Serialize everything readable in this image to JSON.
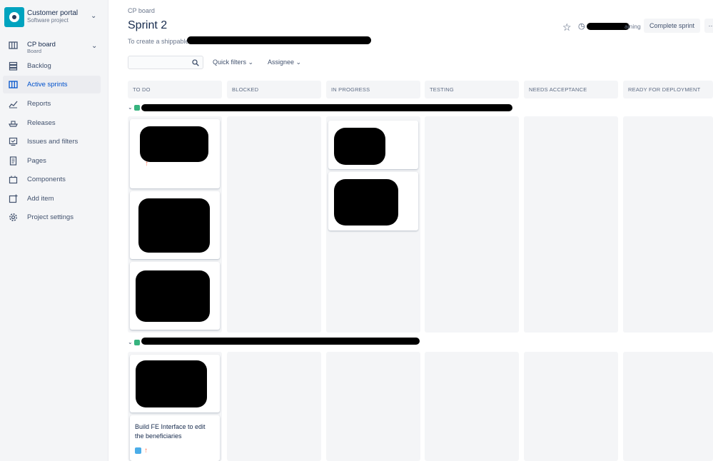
{
  "sidebar": {
    "project_name": "Customer portal",
    "project_type": "Software project",
    "board_name": "CP board",
    "board_sub": "Board",
    "items": [
      {
        "label": "Backlog",
        "icon": "backlog-icon"
      },
      {
        "label": "Active sprints",
        "icon": "board-columns-icon",
        "active": true
      },
      {
        "label": "Reports",
        "icon": "chart-icon"
      },
      {
        "label": "Releases",
        "icon": "ship-icon"
      },
      {
        "label": "Issues and filters",
        "icon": "issues-icon"
      },
      {
        "label": "Pages",
        "icon": "page-icon"
      },
      {
        "label": "Components",
        "icon": "component-icon"
      },
      {
        "label": "Add item",
        "icon": "add-item-icon"
      },
      {
        "label": "Project settings",
        "icon": "gear-icon"
      }
    ]
  },
  "header": {
    "breadcrumb": "CP board",
    "title": "Sprint 2",
    "goal": "To create a shippable",
    "remaining": "aining",
    "complete_button": "Complete sprint"
  },
  "filters": {
    "quick_filters": "Quick filters",
    "assignee": "Assignee"
  },
  "columns": [
    "TO DO",
    "BLOCKED",
    "IN PROGRESS",
    "TESTING",
    "NEEDS ACCEPTANCE",
    "READY FOR DEPLOYMENT"
  ],
  "swimlanes": [
    {
      "color": "#36b37e"
    },
    {
      "color": "#36b37e"
    }
  ],
  "cards": {
    "visible_title": "Build FE Interface to edit the beneficiaries"
  },
  "colors": {
    "accent": "#0052cc",
    "column_bg": "#f4f5f7",
    "story_green": "#36b37e",
    "task_blue": "#4bade8",
    "priority_orange": "#ff7452"
  }
}
